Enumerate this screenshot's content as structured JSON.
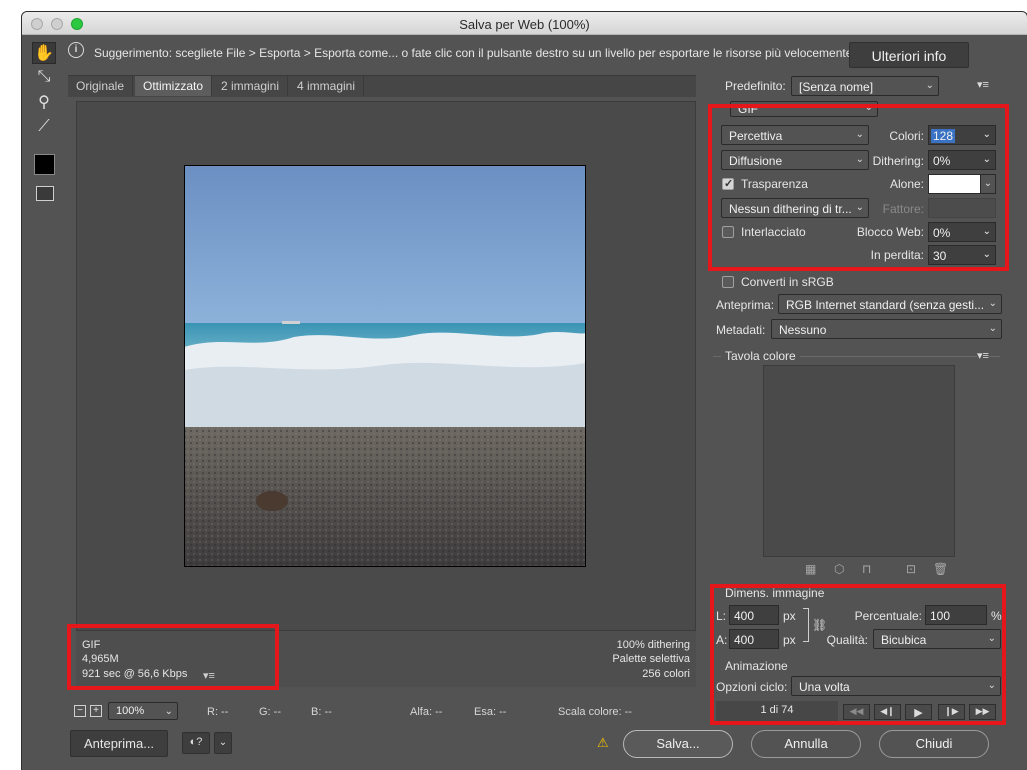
{
  "window": {
    "title": "Salva per Web (100%)"
  },
  "hint": {
    "text": "Suggerimento: scegliete File > Esporta > Esporta come... o fate clic con il pulsante destro su un livello per esportare le risorse più velocemente",
    "more_button": "Ulteriori info"
  },
  "tabs": [
    "Originale",
    "Ottimizzato",
    "2 immagini",
    "4 immagini"
  ],
  "info_left": {
    "format": "GIF",
    "size": "4,965M",
    "time": "921 sec @ 56,6 Kbps"
  },
  "info_right": {
    "dither": "100% dithering",
    "palette": "Palette selettiva",
    "colors": "256 colori"
  },
  "statusbar": {
    "zoom": "100%",
    "r": "R: --",
    "g": "G: --",
    "b": "B: --",
    "alpha": "Alfa: --",
    "hex": "Esa: --",
    "scale": "Scala colore: --"
  },
  "buttons": {
    "preview": "Anteprima...",
    "save": "Salva...",
    "cancel": "Annulla",
    "close": "Chiudi"
  },
  "settings": {
    "preset_label": "Predefinito:",
    "preset": "[Senza nome]",
    "format": "GIF",
    "reduction": "Percettiva",
    "colors_label": "Colori:",
    "colors": "128",
    "dither_algo": "Diffusione",
    "dither_label": "Dithering:",
    "dither": "0%",
    "transparency": "Trasparenza",
    "matte_label": "Alone:",
    "transp_dither": "Nessun dithering di tr...",
    "amount_label": "Fattore:",
    "interlaced": "Interlacciato",
    "websnap_label": "Blocco Web:",
    "websnap": "0%",
    "lossy_label": "In perdita:",
    "lossy": "30",
    "srgb": "Converti in sRGB",
    "preview_label": "Anteprima:",
    "preview": "RGB Internet standard (senza gesti...",
    "metadata_label": "Metadati:",
    "metadata": "Nessuno",
    "color_table": "Tavola colore"
  },
  "image_size": {
    "title": "Dimens. immagine",
    "w_label": "L:",
    "w": "400",
    "h_label": "A:",
    "h": "400",
    "unit": "px",
    "percent_label": "Percentuale:",
    "percent": "100",
    "percent_unit": "%",
    "quality_label": "Qualità:",
    "quality": "Bicubica"
  },
  "animation": {
    "title": "Animazione",
    "loop_label": "Opzioni ciclo:",
    "loop": "Una volta",
    "frame": "1 di 74"
  },
  "colors": {
    "highlight_box": "#e5171b",
    "window_bg": "#535353"
  }
}
